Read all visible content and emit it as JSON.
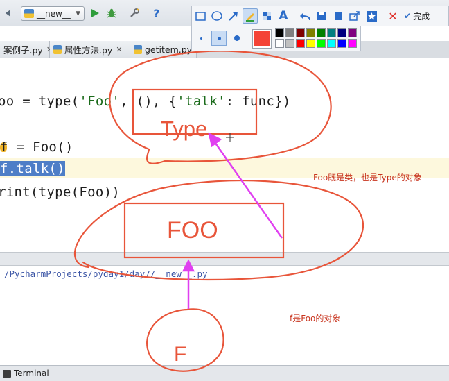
{
  "toolbar": {
    "run_config": "__new__",
    "run_icon": "play-icon",
    "debug_icon": "bug-icon",
    "settings_icon": "wrench-icon",
    "help_label": "?"
  },
  "tabs": [
    {
      "label": "案例子.py"
    },
    {
      "label": "属性方法.py"
    },
    {
      "label": "getitem.py"
    }
  ],
  "code": {
    "line1_prefix": "oo = type(",
    "line1_str1": "'Foo'",
    "line1_mid": ", (), {",
    "line1_str2": "'talk'",
    "line1_suffix": ": func})",
    "line2": "f = Foo()",
    "line3": "f.talk()",
    "line4": "rint(type(Foo))"
  },
  "output": {
    "path": "/PycharmProjects/pyday1/day7/__new__.py"
  },
  "status": {
    "terminal_label": "Terminal"
  },
  "annotations": {
    "note_type": "Foo既是类，也是Type的对象",
    "note_f": "f是Foo的对象",
    "label_type": "Type",
    "label_foo": "FOO",
    "label_f": "F"
  },
  "snip_tool": {
    "done_label": "完成",
    "current_color": "#f44336",
    "palette": [
      "#000000",
      "#808080",
      "#800000",
      "#808000",
      "#008000",
      "#008080",
      "#000080",
      "#800080",
      "#ffffff",
      "#c0c0c0",
      "#ff0000",
      "#ffff00",
      "#00ff00",
      "#00ffff",
      "#0000ff",
      "#ff00ff"
    ]
  },
  "colors": {
    "annotation_red": "#e8553a",
    "arrow_magenta": "#e040f0",
    "selection_blue": "#4e7ec7"
  }
}
